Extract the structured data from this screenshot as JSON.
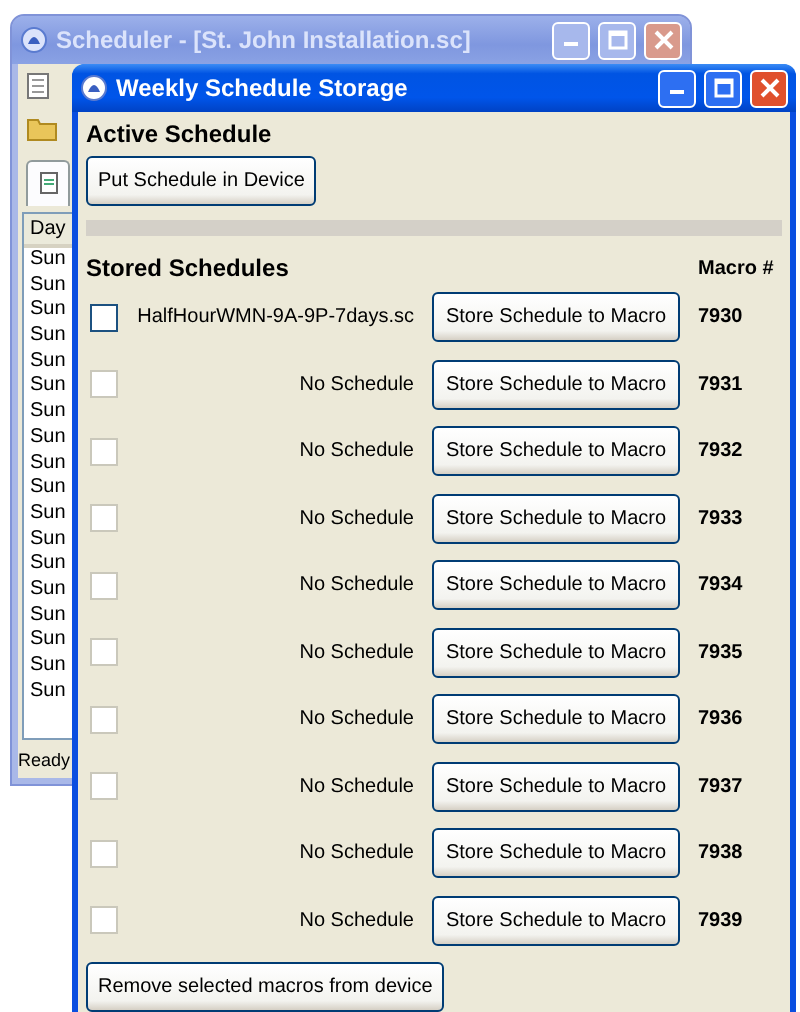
{
  "back_window": {
    "title": "Scheduler - [St. John Installation.sc]",
    "column_header": "Day",
    "rows": [
      "Sun",
      "Sun",
      "Sun",
      "Sun",
      "Sun",
      "Sun",
      "Sun",
      "Sun",
      "Sun",
      "Sun",
      "Sun",
      "Sun",
      "Sun",
      "Sun",
      "Sun",
      "Sun",
      "Sun",
      "Sun"
    ],
    "status_bar": "Ready"
  },
  "window": {
    "title": "Weekly Schedule Storage"
  },
  "active_schedule": {
    "heading": "Active Schedule",
    "button": "Put Schedule in Device"
  },
  "stored_schedules": {
    "heading": "Stored Schedules",
    "macro_header": "Macro #",
    "rows": [
      {
        "name": "HalfHourWMN-9A-9P-7days.sc",
        "checked": false,
        "disabled": false,
        "button": "Store Schedule to Macro",
        "macro": "7930"
      },
      {
        "name": "No Schedule",
        "checked": false,
        "disabled": true,
        "button": "Store Schedule to Macro",
        "macro": "7931"
      },
      {
        "name": "No Schedule",
        "checked": false,
        "disabled": true,
        "button": "Store Schedule to Macro",
        "macro": "7932"
      },
      {
        "name": "No Schedule",
        "checked": false,
        "disabled": true,
        "button": "Store Schedule to Macro",
        "macro": "7933"
      },
      {
        "name": "No Schedule",
        "checked": false,
        "disabled": true,
        "button": "Store Schedule to Macro",
        "macro": "7934"
      },
      {
        "name": "No Schedule",
        "checked": false,
        "disabled": true,
        "button": "Store Schedule to Macro",
        "macro": "7935"
      },
      {
        "name": "No Schedule",
        "checked": false,
        "disabled": true,
        "button": "Store Schedule to Macro",
        "macro": "7936"
      },
      {
        "name": "No Schedule",
        "checked": false,
        "disabled": true,
        "button": "Store Schedule to Macro",
        "macro": "7937"
      },
      {
        "name": "No Schedule",
        "checked": false,
        "disabled": true,
        "button": "Store Schedule to Macro",
        "macro": "7938"
      },
      {
        "name": "No Schedule",
        "checked": false,
        "disabled": true,
        "button": "Store Schedule to Macro",
        "macro": "7939"
      }
    ]
  },
  "remove_button": "Remove selected macros from device"
}
